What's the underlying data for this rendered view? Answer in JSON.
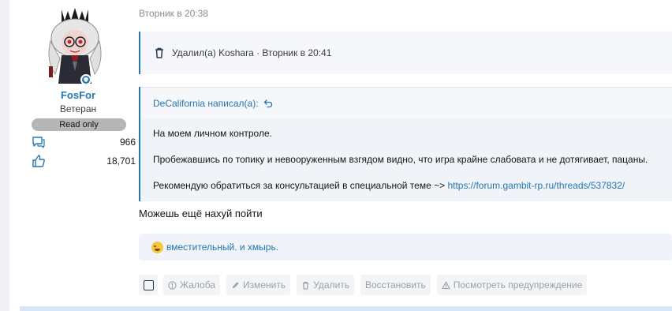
{
  "user": {
    "name": "FosFor",
    "title": "Ветеран",
    "banner": "Read only",
    "messages_count": "966",
    "reactions_count": "18,701"
  },
  "post": {
    "date": "Вторник в 20:38",
    "deleted_notice": "Удалил(а) Koshara · Вторник в 20:41",
    "quote": {
      "author": "DeCalifornia написал(а):",
      "line1": "На моем личном контроле.",
      "line2": "Пробежавшись по топику и невооруженным взгядом видно, что игра крайне слабовата и не дотягивает, пацаны.",
      "line3_prefix": "Рекомендую обратиться за консультацией в специальной теме ~> ",
      "line3_link": "https://forum.gambit-rp.ru/threads/537832/"
    },
    "body": "Можешь ещё нахуй пойти",
    "reactions_text": "вместительный. и хмырь."
  },
  "actions": {
    "report": "Жалоба",
    "edit": "Изменить",
    "delete": "Удалить",
    "restore": "Восстановить",
    "warning": "Посмотреть предупреждение"
  },
  "colors": {
    "accent": "#2577b1",
    "muted": "#9aa1ab"
  }
}
